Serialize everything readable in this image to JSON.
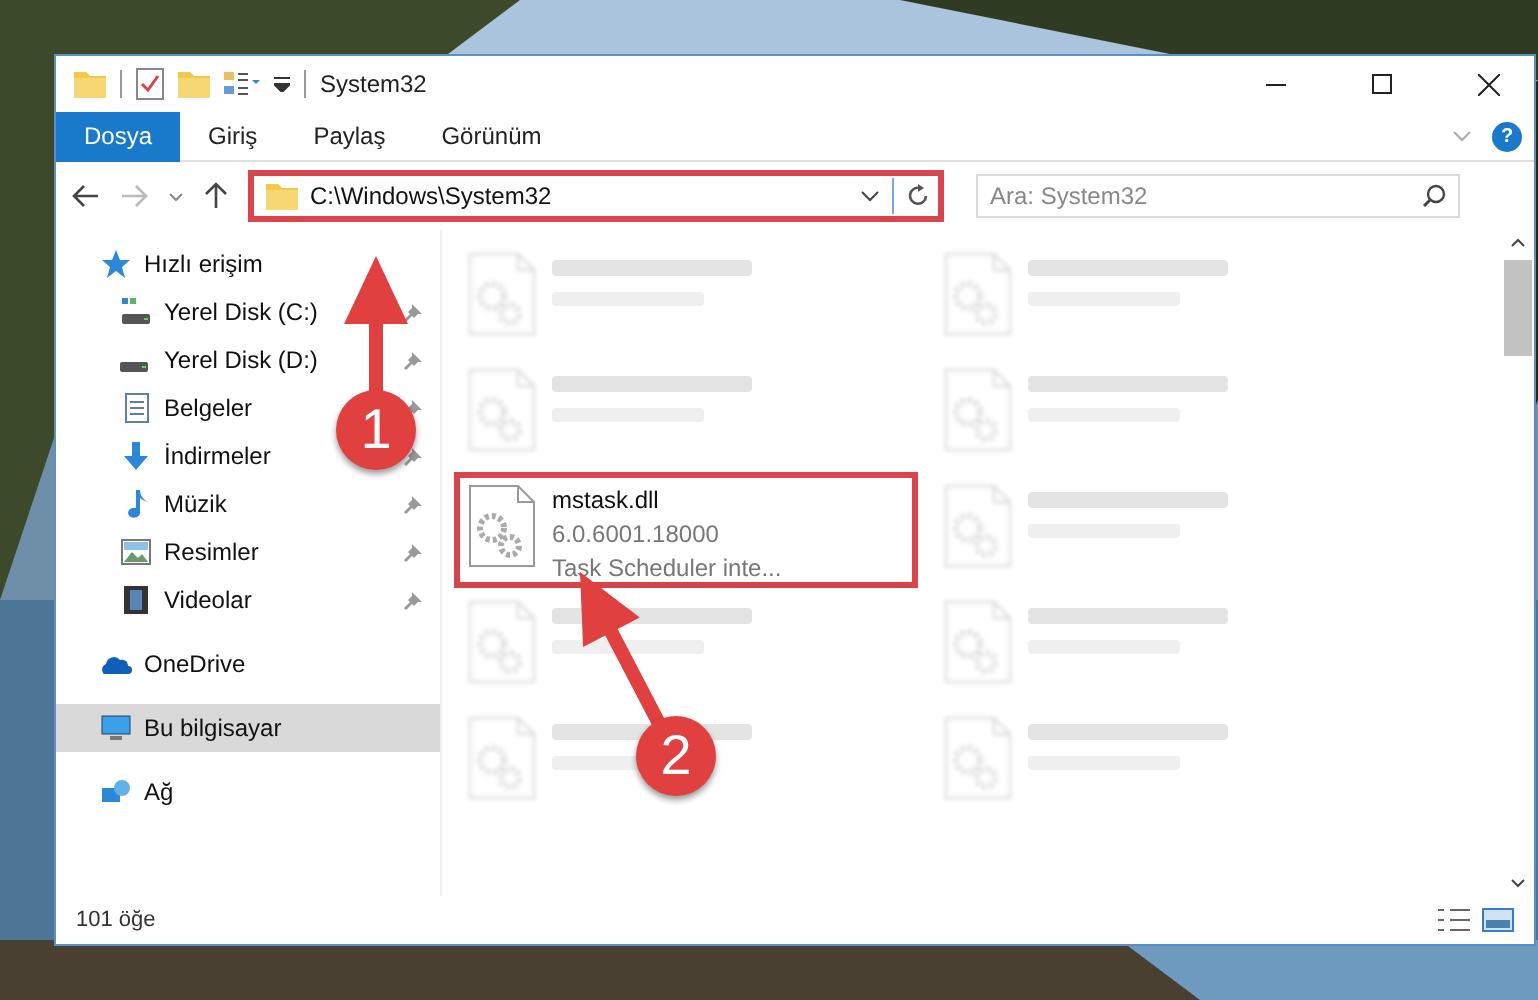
{
  "window": {
    "title": "System32"
  },
  "ribbon_tabs": [
    {
      "label": "Dosya",
      "selected": true
    },
    {
      "label": "Giriş",
      "selected": false
    },
    {
      "label": "Paylaş",
      "selected": false
    },
    {
      "label": "Görünüm",
      "selected": false
    }
  ],
  "help": {
    "label": "?"
  },
  "address_bar": {
    "path": "C:\\Windows\\System32",
    "annotated": true
  },
  "search": {
    "placeholder": "Ara: System32"
  },
  "sidebar": {
    "items": [
      {
        "label": "Hızlı erişim",
        "kind": "star",
        "selected": false,
        "children": [
          {
            "label": "Yerel Disk (C:)",
            "kind": "system-drive",
            "pinned": true
          },
          {
            "label": "Yerel Disk (D:)",
            "kind": "drive",
            "pinned": true
          },
          {
            "label": "Belgeler",
            "kind": "documents",
            "pinned": true
          },
          {
            "label": "İndirmeler",
            "kind": "downloads",
            "pinned": true
          },
          {
            "label": "Müzik",
            "kind": "music",
            "pinned": true
          },
          {
            "label": "Resimler",
            "kind": "pictures",
            "pinned": true
          },
          {
            "label": "Videolar",
            "kind": "videos",
            "pinned": true
          }
        ]
      },
      {
        "label": "OneDrive",
        "kind": "cloud",
        "selected": false
      },
      {
        "label": "Bu bilgisayar",
        "kind": "computer",
        "selected": true
      },
      {
        "label": "Ağ",
        "kind": "network",
        "selected": false
      }
    ]
  },
  "files": [
    {
      "kind": "blurred"
    },
    {
      "kind": "blurred"
    },
    {
      "kind": "blurred"
    },
    {
      "kind": "blurred"
    },
    {
      "kind": "file",
      "name": "mstask.dll",
      "lines": [
        "6.0.6001.18000",
        "Task Scheduler inte..."
      ],
      "annotated": true
    },
    {
      "kind": "blurred"
    },
    {
      "kind": "blurred"
    },
    {
      "kind": "blurred"
    },
    {
      "kind": "blurred"
    },
    {
      "kind": "blurred"
    }
  ],
  "status_bar": {
    "item_count": "101 öğe"
  },
  "callouts": [
    {
      "label": "1"
    },
    {
      "label": "2"
    }
  ]
}
